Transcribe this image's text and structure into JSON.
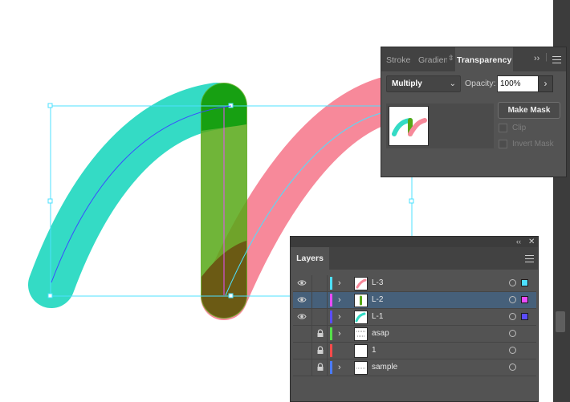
{
  "transparency_panel": {
    "tabs": [
      {
        "label": "Stroke"
      },
      {
        "label": "Gradient"
      },
      {
        "label": "Transparency"
      }
    ],
    "expand_icon": "double-chevron-right-icon",
    "menu_icon": "hamburger-menu-icon",
    "blend_mode": "Multiply",
    "opacity_label": "Opacity:",
    "opacity_value": "100%",
    "make_mask_label": "Make Mask",
    "clip_label": "Clip",
    "invert_mask_label": "Invert Mask"
  },
  "layers_panel": {
    "title": "Layers",
    "collapse_icon": "double-chevron-left-icon",
    "close_icon": "close-icon",
    "menu_icon": "hamburger-menu-icon",
    "layers": [
      {
        "name": "L-3",
        "visible": true,
        "locked": false,
        "color": "#4de0ff",
        "selected": false,
        "expandable": true
      },
      {
        "name": "L-2",
        "visible": true,
        "locked": false,
        "color": "#e84bff",
        "selected": true,
        "expandable": true
      },
      {
        "name": "L-1",
        "visible": true,
        "locked": false,
        "color": "#5a4cff",
        "selected": false,
        "expandable": true
      },
      {
        "name": "asap",
        "visible": false,
        "locked": true,
        "color": "#55e04a",
        "selected": false,
        "expandable": true
      },
      {
        "name": "1",
        "visible": false,
        "locked": true,
        "color": "#ff4a4a",
        "selected": false,
        "expandable": false
      },
      {
        "name": "sample",
        "visible": false,
        "locked": true,
        "color": "#4a7bff",
        "selected": false,
        "expandable": true
      }
    ]
  },
  "artwork": {
    "stroke_colors": {
      "teal": "#34dbc5",
      "green": "#57a816",
      "pink": "#f7899a",
      "olive": "#6b5a14",
      "dark_green": "#17a012",
      "selection": "#4de0ff"
    }
  }
}
